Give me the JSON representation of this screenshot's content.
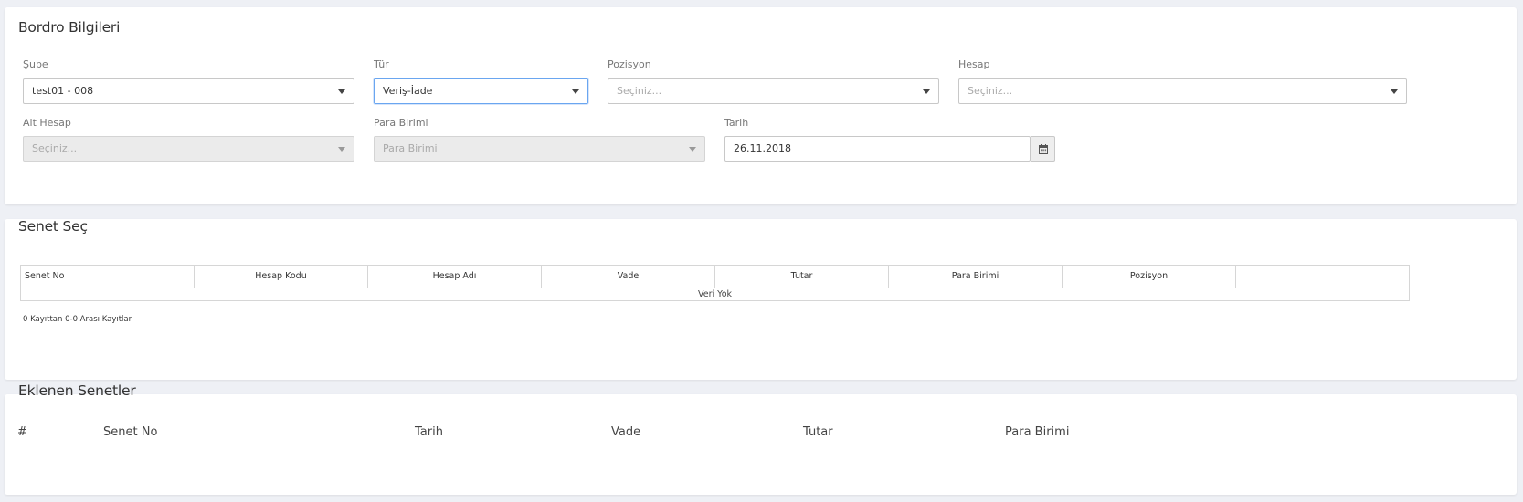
{
  "bordro": {
    "title": "Bordro Bilgileri",
    "sube": {
      "label": "Şube",
      "value": "test01 - 008"
    },
    "tur": {
      "label": "Tür",
      "value": "Veriş-İade"
    },
    "pozisyon": {
      "label": "Pozisyon",
      "placeholder": "Seçiniz..."
    },
    "hesap": {
      "label": "Hesap",
      "placeholder": "Seçiniz..."
    },
    "alt_hesap": {
      "label": "Alt Hesap",
      "placeholder": "Seçiniz..."
    },
    "para_birimi": {
      "label": "Para Birimi",
      "placeholder": "Para Birimi"
    },
    "tarih": {
      "label": "Tarih",
      "value": "26.11.2018"
    }
  },
  "senet_sec": {
    "title": "Senet Seç",
    "columns": [
      "Senet No",
      "Hesap Kodu",
      "Hesap Adı",
      "Vade",
      "Tutar",
      "Para Birimi",
      "Pozisyon",
      ""
    ],
    "empty_text": "Veri Yok",
    "info_text": "0 Kayıttan 0-0 Arası Kayıtlar"
  },
  "eklenen": {
    "title": "Eklenen Senetler",
    "columns": [
      "#",
      "Senet No",
      "Tarih",
      "Vade",
      "Tutar",
      "Para Birimi"
    ]
  },
  "colors": {
    "background": "#eef0f5",
    "panel": "#ffffff",
    "focus_border": "#6aa6f0",
    "disabled": "#ebebeb"
  }
}
